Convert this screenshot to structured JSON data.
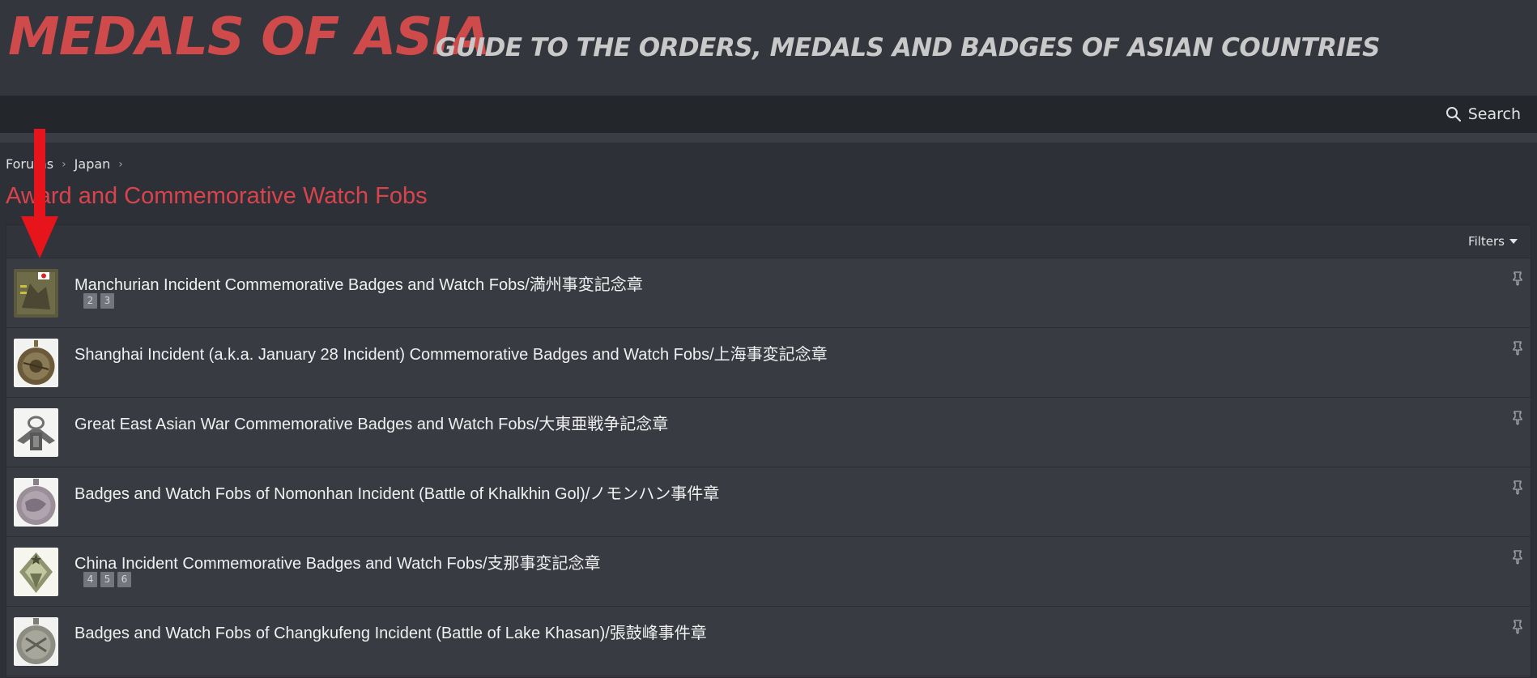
{
  "header": {
    "logo": "MEDALS OF ASIA",
    "tagline": "GUIDE TO THE ORDERS, MEDALS AND BADGES OF ASIAN COUNTRIES"
  },
  "nav": {
    "search_label": "Search",
    "search_icon": "search-icon"
  },
  "breadcrumb": {
    "items": [
      "Forums",
      "Japan"
    ]
  },
  "page": {
    "title": "Award and Commemorative Watch Fobs"
  },
  "filters": {
    "label": "Filters"
  },
  "threads": [
    {
      "title": "Manchurian Incident Commemorative Badges and Watch Fobs/満州事変記念章",
      "pages": [
        "2",
        "3"
      ]
    },
    {
      "title": "Shanghai Incident (a.k.a. January 28 Incident) Commemorative Badges and Watch Fobs/上海事変記念章",
      "pages": []
    },
    {
      "title": "Great East Asian War Commemorative Badges and Watch Fobs/大東亜戦争記念章",
      "pages": []
    },
    {
      "title": "Badges and Watch Fobs of Nomonhan Incident (Battle of Khalkhin Gol)/ノモンハン事件章",
      "pages": []
    },
    {
      "title": "China Incident Commemorative Badges and Watch Fobs/支那事変記念章",
      "pages": [
        "4",
        "5",
        "6"
      ]
    },
    {
      "title": "Badges and Watch Fobs of Changkufeng Incident (Battle of Lake Khasan)/張鼓峰事件章",
      "pages": []
    }
  ],
  "colors": {
    "accent_red": "#cf4a4a",
    "title_red": "#d9444c",
    "header_bg": "#33363d",
    "nav_bg": "#23262b",
    "arrow_red": "#e8141c"
  }
}
